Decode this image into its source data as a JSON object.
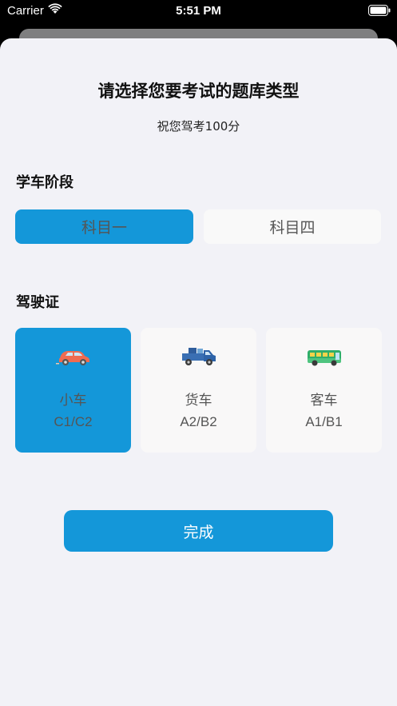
{
  "status_bar": {
    "carrier": "Carrier",
    "time": "5:51 PM"
  },
  "header": {
    "title": "请选择您要考试的题库类型",
    "subtitle": "祝您驾考100分"
  },
  "stage": {
    "label": "学车阶段",
    "options": [
      {
        "label": "科目一",
        "selected": true
      },
      {
        "label": "科目四",
        "selected": false
      }
    ]
  },
  "license": {
    "label": "驾驶证",
    "options": [
      {
        "name": "小车",
        "code": "C1/C2",
        "icon": "car-icon",
        "selected": true
      },
      {
        "name": "货车",
        "code": "A2/B2",
        "icon": "truck-icon",
        "selected": false
      },
      {
        "name": "客车",
        "code": "A1/B1",
        "icon": "bus-icon",
        "selected": false
      }
    ]
  },
  "done_button": "完成",
  "colors": {
    "accent": "#1497d9",
    "background": "#f2f2f7",
    "card": "#f9f9f9"
  }
}
